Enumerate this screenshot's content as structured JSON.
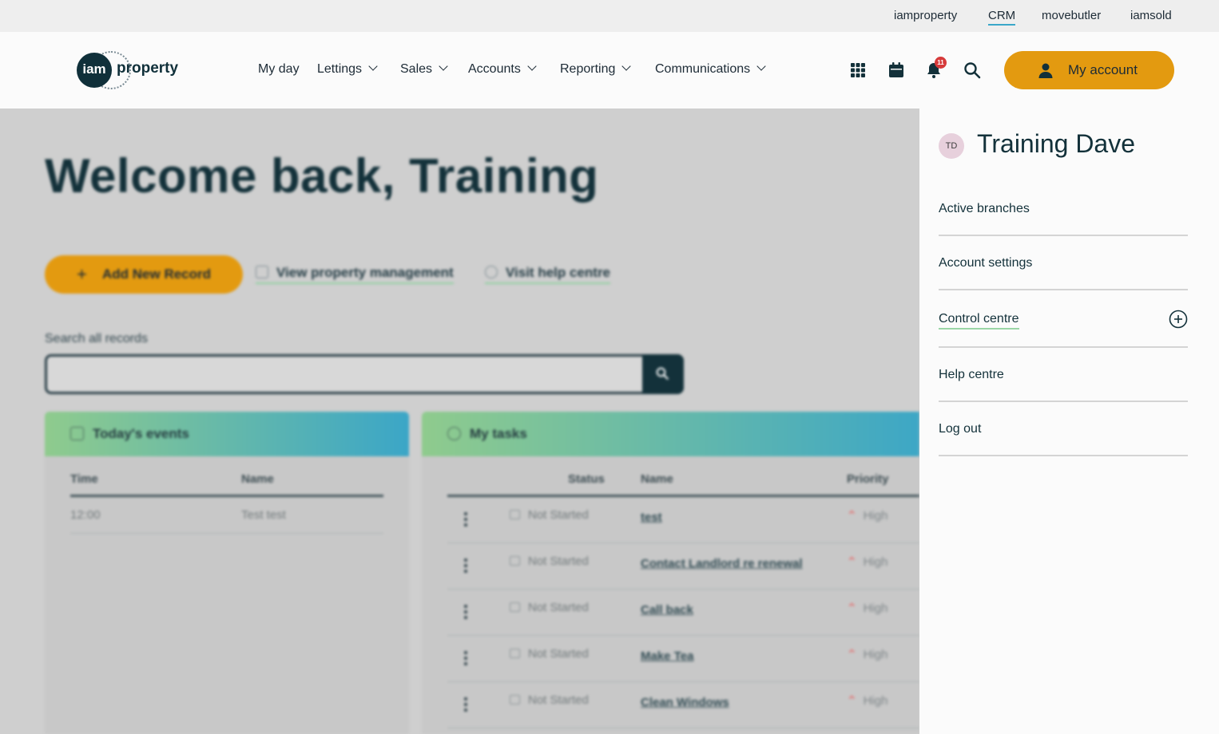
{
  "topstrip": {
    "links": [
      "iamproperty",
      "CRM",
      "movebutler",
      "iamsold"
    ],
    "active": "CRM"
  },
  "header": {
    "logo": {
      "circle_text": "iam",
      "word": "property"
    },
    "nav": [
      "My day",
      "Lettings",
      "Sales",
      "Accounts",
      "Reporting",
      "Communications"
    ],
    "notifications_count": "11",
    "my_account_label": "My account",
    "accent_color": "#e39a10"
  },
  "main": {
    "welcome": "Welcome back, Training",
    "add_new_record": "Add New Record",
    "view_property_management": "View property management",
    "visit_help_centre": "Visit help centre",
    "search_label": "Search all records",
    "events": {
      "title": "Today's events",
      "columns": [
        "Time",
        "Name"
      ],
      "rows": [
        {
          "time": "12:00",
          "name": "Test test"
        }
      ]
    },
    "tasks": {
      "title": "My tasks",
      "columns": [
        "Status",
        "Name",
        "Priority"
      ],
      "rows": [
        {
          "status": "Not Started",
          "name": "test",
          "priority": "High"
        },
        {
          "status": "Not Started",
          "name": "Contact Landlord re renewal",
          "priority": "High"
        },
        {
          "status": "Not Started",
          "name": "Call back",
          "priority": "High"
        },
        {
          "status": "Not Started",
          "name": "Make Tea",
          "priority": "High"
        },
        {
          "status": "Not Started",
          "name": "Clean Windows",
          "priority": "High"
        }
      ]
    }
  },
  "account_menu": {
    "initials": "TD",
    "user_name": "Training Dave",
    "items": [
      "Active branches",
      "Account settings",
      "Control centre",
      "Help centre",
      "Log out"
    ]
  }
}
